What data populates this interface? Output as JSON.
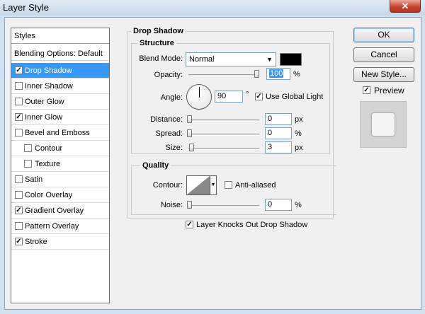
{
  "window": {
    "title": "Layer Style",
    "close_glyph": "✕"
  },
  "styles_panel": {
    "header": "Styles",
    "blending_options": "Blending Options: Default",
    "items": [
      {
        "label": "Drop Shadow",
        "checked": true,
        "active": true,
        "indent": false
      },
      {
        "label": "Inner Shadow",
        "checked": false,
        "active": false,
        "indent": false
      },
      {
        "label": "Outer Glow",
        "checked": false,
        "active": false,
        "indent": false
      },
      {
        "label": "Inner Glow",
        "checked": true,
        "active": false,
        "indent": false
      },
      {
        "label": "Bevel and Emboss",
        "checked": false,
        "active": false,
        "indent": false
      },
      {
        "label": "Contour",
        "checked": false,
        "active": false,
        "indent": true
      },
      {
        "label": "Texture",
        "checked": false,
        "active": false,
        "indent": true
      },
      {
        "label": "Satin",
        "checked": false,
        "active": false,
        "indent": false
      },
      {
        "label": "Color Overlay",
        "checked": false,
        "active": false,
        "indent": false
      },
      {
        "label": "Gradient Overlay",
        "checked": true,
        "active": false,
        "indent": false
      },
      {
        "label": "Pattern Overlay",
        "checked": false,
        "active": false,
        "indent": false
      },
      {
        "label": "Stroke",
        "checked": true,
        "active": false,
        "indent": false
      }
    ]
  },
  "drop_shadow": {
    "title": "Drop Shadow",
    "structure": {
      "title": "Structure",
      "blend_mode_label": "Blend Mode:",
      "blend_mode_value": "Normal",
      "shadow_color": "#000000",
      "opacity_label": "Opacity:",
      "opacity_value": "100",
      "opacity_unit": "%",
      "opacity_level": 1.0,
      "angle_label": "Angle:",
      "angle_value": "90",
      "angle_unit": "°",
      "use_global_light_label": "Use Global Light",
      "use_global_light": true,
      "distance_label": "Distance:",
      "distance_value": "0",
      "distance_unit": "px",
      "spread_label": "Spread:",
      "spread_value": "0",
      "spread_unit": "%",
      "size_label": "Size:",
      "size_value": "3",
      "size_unit": "px"
    },
    "quality": {
      "title": "Quality",
      "contour_label": "Contour:",
      "anti_aliased_label": "Anti-aliased",
      "anti_aliased": false,
      "noise_label": "Noise:",
      "noise_value": "0",
      "noise_unit": "%"
    },
    "knockout_label": "Layer Knocks Out Drop Shadow",
    "knockout": true
  },
  "buttons": {
    "ok": "OK",
    "cancel": "Cancel",
    "new_style": "New Style...",
    "preview_label": "Preview",
    "preview_checked": true
  }
}
